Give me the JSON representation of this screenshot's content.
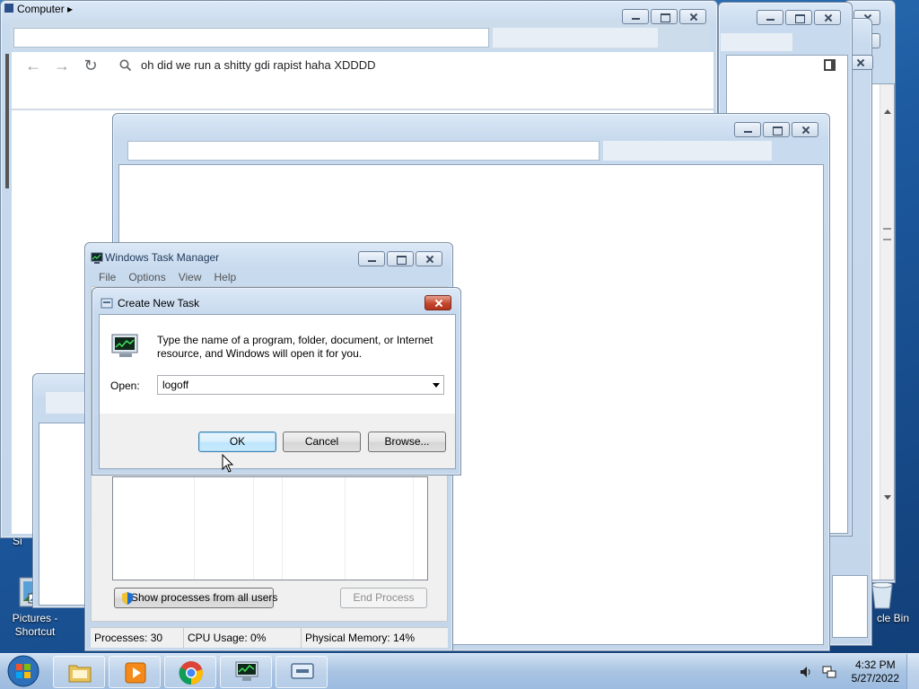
{
  "desktop": {
    "icons": [
      {
        "label": "Pictures - Shortcut"
      },
      {
        "label": "cle Bin"
      }
    ],
    "fragment_label": "Si"
  },
  "explorer": {
    "breadcrumb": "Computer ▸"
  },
  "browser": {
    "address_text": "oh did we run a shitty gdi rapist haha XDDDD"
  },
  "task_manager": {
    "title": "Windows Task Manager",
    "menu": [
      "File",
      "Options",
      "View",
      "Help"
    ],
    "show_all_label": "Show processes from all users",
    "end_process_label": "End Process",
    "status": {
      "processes": "Processes: 30",
      "cpu": "CPU Usage: 0%",
      "memory": "Physical Memory: 14%"
    }
  },
  "run_dialog": {
    "title": "Create New Task",
    "prompt": "Type the name of a program, folder, document, or Internet resource, and Windows will open it for you.",
    "open_label": "Open:",
    "open_value": "logoff",
    "ok_label": "OK",
    "cancel_label": "Cancel",
    "browse_label": "Browse..."
  },
  "taskbar": {
    "apps": [
      "windows-explorer",
      "media-player",
      "chrome",
      "task-manager",
      "run"
    ],
    "time": "4:32 PM",
    "date": "5/27/2022"
  },
  "colors": {
    "desktop": "#1d5aa0",
    "taskbar": "#a9c4e2",
    "close_red": "#c4472e"
  }
}
